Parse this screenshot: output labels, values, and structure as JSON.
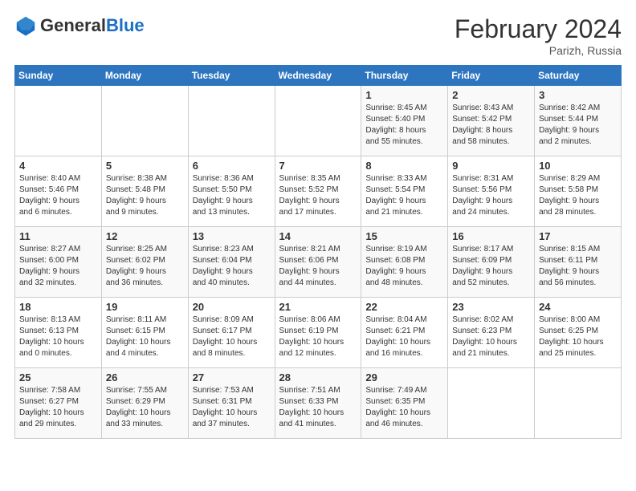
{
  "header": {
    "logo_general": "General",
    "logo_blue": "Blue",
    "month_title": "February 2024",
    "location": "Parizh, Russia"
  },
  "days_of_week": [
    "Sunday",
    "Monday",
    "Tuesday",
    "Wednesday",
    "Thursday",
    "Friday",
    "Saturday"
  ],
  "weeks": [
    [
      {
        "day": "",
        "info": ""
      },
      {
        "day": "",
        "info": ""
      },
      {
        "day": "",
        "info": ""
      },
      {
        "day": "",
        "info": ""
      },
      {
        "day": "1",
        "info": "Sunrise: 8:45 AM\nSunset: 5:40 PM\nDaylight: 8 hours\nand 55 minutes."
      },
      {
        "day": "2",
        "info": "Sunrise: 8:43 AM\nSunset: 5:42 PM\nDaylight: 8 hours\nand 58 minutes."
      },
      {
        "day": "3",
        "info": "Sunrise: 8:42 AM\nSunset: 5:44 PM\nDaylight: 9 hours\nand 2 minutes."
      }
    ],
    [
      {
        "day": "4",
        "info": "Sunrise: 8:40 AM\nSunset: 5:46 PM\nDaylight: 9 hours\nand 6 minutes."
      },
      {
        "day": "5",
        "info": "Sunrise: 8:38 AM\nSunset: 5:48 PM\nDaylight: 9 hours\nand 9 minutes."
      },
      {
        "day": "6",
        "info": "Sunrise: 8:36 AM\nSunset: 5:50 PM\nDaylight: 9 hours\nand 13 minutes."
      },
      {
        "day": "7",
        "info": "Sunrise: 8:35 AM\nSunset: 5:52 PM\nDaylight: 9 hours\nand 17 minutes."
      },
      {
        "day": "8",
        "info": "Sunrise: 8:33 AM\nSunset: 5:54 PM\nDaylight: 9 hours\nand 21 minutes."
      },
      {
        "day": "9",
        "info": "Sunrise: 8:31 AM\nSunset: 5:56 PM\nDaylight: 9 hours\nand 24 minutes."
      },
      {
        "day": "10",
        "info": "Sunrise: 8:29 AM\nSunset: 5:58 PM\nDaylight: 9 hours\nand 28 minutes."
      }
    ],
    [
      {
        "day": "11",
        "info": "Sunrise: 8:27 AM\nSunset: 6:00 PM\nDaylight: 9 hours\nand 32 minutes."
      },
      {
        "day": "12",
        "info": "Sunrise: 8:25 AM\nSunset: 6:02 PM\nDaylight: 9 hours\nand 36 minutes."
      },
      {
        "day": "13",
        "info": "Sunrise: 8:23 AM\nSunset: 6:04 PM\nDaylight: 9 hours\nand 40 minutes."
      },
      {
        "day": "14",
        "info": "Sunrise: 8:21 AM\nSunset: 6:06 PM\nDaylight: 9 hours\nand 44 minutes."
      },
      {
        "day": "15",
        "info": "Sunrise: 8:19 AM\nSunset: 6:08 PM\nDaylight: 9 hours\nand 48 minutes."
      },
      {
        "day": "16",
        "info": "Sunrise: 8:17 AM\nSunset: 6:09 PM\nDaylight: 9 hours\nand 52 minutes."
      },
      {
        "day": "17",
        "info": "Sunrise: 8:15 AM\nSunset: 6:11 PM\nDaylight: 9 hours\nand 56 minutes."
      }
    ],
    [
      {
        "day": "18",
        "info": "Sunrise: 8:13 AM\nSunset: 6:13 PM\nDaylight: 10 hours\nand 0 minutes."
      },
      {
        "day": "19",
        "info": "Sunrise: 8:11 AM\nSunset: 6:15 PM\nDaylight: 10 hours\nand 4 minutes."
      },
      {
        "day": "20",
        "info": "Sunrise: 8:09 AM\nSunset: 6:17 PM\nDaylight: 10 hours\nand 8 minutes."
      },
      {
        "day": "21",
        "info": "Sunrise: 8:06 AM\nSunset: 6:19 PM\nDaylight: 10 hours\nand 12 minutes."
      },
      {
        "day": "22",
        "info": "Sunrise: 8:04 AM\nSunset: 6:21 PM\nDaylight: 10 hours\nand 16 minutes."
      },
      {
        "day": "23",
        "info": "Sunrise: 8:02 AM\nSunset: 6:23 PM\nDaylight: 10 hours\nand 21 minutes."
      },
      {
        "day": "24",
        "info": "Sunrise: 8:00 AM\nSunset: 6:25 PM\nDaylight: 10 hours\nand 25 minutes."
      }
    ],
    [
      {
        "day": "25",
        "info": "Sunrise: 7:58 AM\nSunset: 6:27 PM\nDaylight: 10 hours\nand 29 minutes."
      },
      {
        "day": "26",
        "info": "Sunrise: 7:55 AM\nSunset: 6:29 PM\nDaylight: 10 hours\nand 33 minutes."
      },
      {
        "day": "27",
        "info": "Sunrise: 7:53 AM\nSunset: 6:31 PM\nDaylight: 10 hours\nand 37 minutes."
      },
      {
        "day": "28",
        "info": "Sunrise: 7:51 AM\nSunset: 6:33 PM\nDaylight: 10 hours\nand 41 minutes."
      },
      {
        "day": "29",
        "info": "Sunrise: 7:49 AM\nSunset: 6:35 PM\nDaylight: 10 hours\nand 46 minutes."
      },
      {
        "day": "",
        "info": ""
      },
      {
        "day": "",
        "info": ""
      }
    ]
  ]
}
